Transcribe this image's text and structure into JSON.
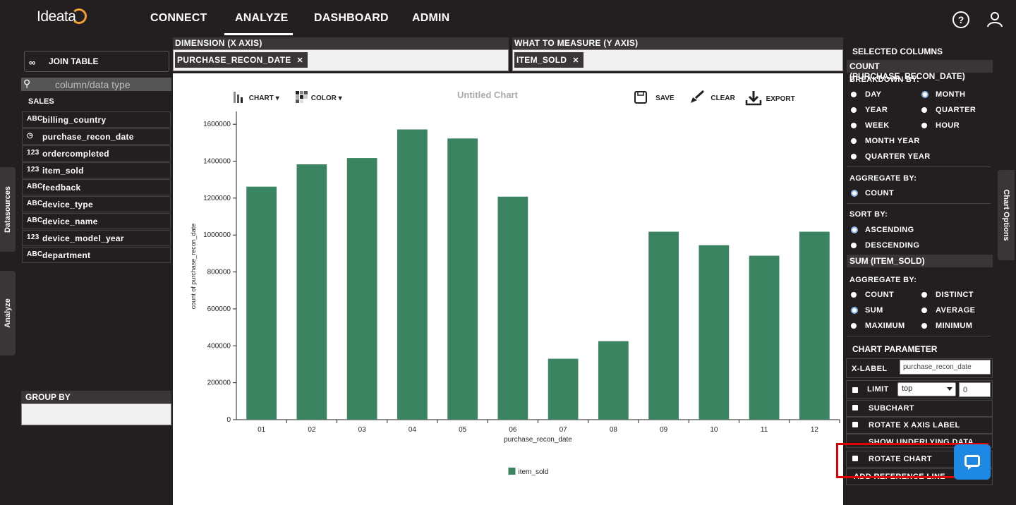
{
  "app": {
    "logo_text": "Ideata"
  },
  "nav": {
    "items": [
      "CONNECT",
      "ANALYZE",
      "DASHBOARD",
      "ADMIN"
    ],
    "active": "ANALYZE",
    "help_icon": "question-circle-icon",
    "user_icon": "user-icon"
  },
  "side_tabs": {
    "datasources": "Datasources",
    "analyze": "Analyze"
  },
  "left": {
    "join_table": "JOIN TABLE",
    "search_placeholder": "column/data type",
    "group_name": "SALES",
    "fields": [
      {
        "name": "billing_country",
        "type": "text"
      },
      {
        "name": "purchase_recon_date",
        "type": "date"
      },
      {
        "name": "ordercompleted",
        "type": "number"
      },
      {
        "name": "item_sold",
        "type": "number"
      },
      {
        "name": "feedback",
        "type": "text"
      },
      {
        "name": "device_type",
        "type": "text"
      },
      {
        "name": "device_name",
        "type": "text"
      },
      {
        "name": "device_model_year",
        "type": "number"
      },
      {
        "name": "department",
        "type": "text"
      }
    ],
    "group_by": "GROUP BY"
  },
  "dimension": {
    "label": "DIMENSION (X AXIS)",
    "chip": "PURCHASE_RECON_DATE"
  },
  "measure": {
    "label": "WHAT TO MEASURE (Y AXIS)",
    "chip": "ITEM_SOLD"
  },
  "toolbar": {
    "chart": "CHART",
    "color": "COLOR",
    "title": "Untitled Chart",
    "save": "SAVE",
    "clear": "CLEAR",
    "export": "EXPORT"
  },
  "chart_data": {
    "type": "bar",
    "categories": [
      "01",
      "02",
      "03",
      "04",
      "05",
      "06",
      "07",
      "08",
      "09",
      "10",
      "11",
      "12"
    ],
    "series": [
      {
        "name": "item_sold",
        "values": [
          1262000,
          1383000,
          1417000,
          1572000,
          1523000,
          1208000,
          330000,
          425000,
          1018000,
          945000,
          888000,
          1018000
        ],
        "color": "#3b8461"
      }
    ],
    "xlabel": "purchase_recon_date",
    "ylabel": "count of purchase_recon_date",
    "ylim": [
      0,
      1700000
    ],
    "yticks": [
      0,
      200000,
      400000,
      600000,
      800000,
      1000000,
      1200000,
      1400000,
      1600000
    ],
    "legend": "bottom"
  },
  "right": {
    "selected_columns": "SELECTED COLUMNS",
    "col1": {
      "header": "COUNT (PURCHASE_RECON_DATE)",
      "breakdown_label": "BREAKDOWN BY:",
      "breakdown_options": [
        "DAY",
        "MONTH",
        "YEAR",
        "QUARTER",
        "WEEK",
        "HOUR",
        "MONTH YEAR",
        "QUARTER YEAR"
      ],
      "breakdown_selected": "MONTH",
      "aggregate_label": "AGGREGATE BY:",
      "aggregate_options": [
        "COUNT"
      ],
      "aggregate_selected": "COUNT",
      "sort_label": "SORT BY:",
      "sort_options": [
        "ASCENDING",
        "DESCENDING"
      ],
      "sort_selected": "ASCENDING"
    },
    "col2": {
      "header": "SUM (ITEM_SOLD)",
      "aggregate_label": "AGGREGATE BY:",
      "aggregate_options": [
        "COUNT",
        "DISTINCT",
        "SUM",
        "AVERAGE",
        "MAXIMUM",
        "MINIMUM"
      ],
      "aggregate_selected": "SUM"
    },
    "chart_parameter": "CHART PARAMETER",
    "x_label": "X-LABEL",
    "x_label_value": "purchase_recon_date",
    "limit": "LIMIT",
    "limit_mode": "top",
    "limit_value": "0",
    "subchart": "SUBCHART",
    "rotate_x": "ROTATE X AXIS LABEL",
    "show_underlying": "SHOW UNDERLYING DATA",
    "rotate_chart": "ROTATE CHART",
    "add_reference": "ADD REFERENCE LINE",
    "chart_options_tab": "Chart Options"
  },
  "colors": {
    "bg": "#231f20",
    "bar": "#3b8461",
    "highlight": "#e00000",
    "chat": "#1e88e5"
  }
}
